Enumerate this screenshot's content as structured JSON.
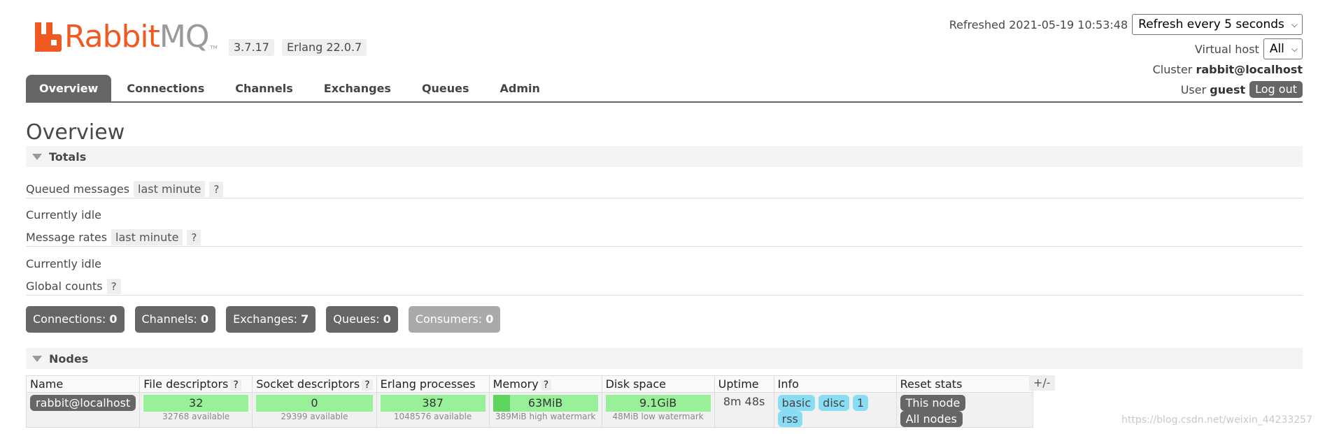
{
  "brand": {
    "name_rabbit": "Rabbit",
    "name_mq": "MQ",
    "tm": "TM"
  },
  "versions": {
    "rabbitmq": "3.7.17",
    "erlang": "Erlang 22.0.7"
  },
  "status": {
    "refreshed_label": "Refreshed 2021-05-19 10:53:48",
    "refresh_select": "Refresh every 5 seconds",
    "vhost_label": "Virtual host",
    "vhost_select": "All",
    "cluster_label": "Cluster",
    "cluster_value": "rabbit@localhost",
    "user_label": "User",
    "user_value": "guest",
    "logout": "Log out"
  },
  "tabs": [
    "Overview",
    "Connections",
    "Channels",
    "Exchanges",
    "Queues",
    "Admin"
  ],
  "page_title": "Overview",
  "totals": {
    "heading": "Totals",
    "queued_label": "Queued messages",
    "queued_range": "last minute",
    "queued_state": "Currently idle",
    "rates_label": "Message rates",
    "rates_range": "last minute",
    "rates_state": "Currently idle",
    "global_label": "Global counts",
    "help": "?"
  },
  "counts": [
    {
      "label": "Connections:",
      "value": "0"
    },
    {
      "label": "Channels:",
      "value": "0"
    },
    {
      "label": "Exchanges:",
      "value": "7"
    },
    {
      "label": "Queues:",
      "value": "0"
    },
    {
      "label": "Consumers:",
      "value": "0"
    }
  ],
  "nodes": {
    "heading": "Nodes",
    "toggle": "+/-",
    "columns": [
      "Name",
      "File descriptors",
      "Socket descriptors",
      "Erlang processes",
      "Memory",
      "Disk space",
      "Uptime",
      "Info",
      "Reset stats"
    ],
    "row": {
      "name": "rabbit@localhost",
      "fd_used": "32",
      "fd_available": "32768 available",
      "fd_fraction": 0.001,
      "sock_used": "0",
      "sock_available": "29399 available",
      "sock_fraction": 0.0,
      "proc_used": "387",
      "proc_available": "1048576 available",
      "proc_fraction": 0.0004,
      "memory_used": "63MiB",
      "memory_watermark": "389MiB high watermark",
      "memory_fraction": 0.16,
      "disk_free": "9.1GiB",
      "disk_watermark": "48MiB low watermark",
      "uptime": "8m 48s",
      "info_tags": [
        "basic",
        "disc",
        "1",
        "rss"
      ],
      "reset_this": "This node",
      "reset_all": "All nodes"
    }
  },
  "watermark": "https://blog.csdn.net/weixin_44233257",
  "colors": {
    "accent": "#f05a22",
    "tab_active": "#666666",
    "gauge_green": "#98f198",
    "info_tag": "#88ddf5"
  }
}
